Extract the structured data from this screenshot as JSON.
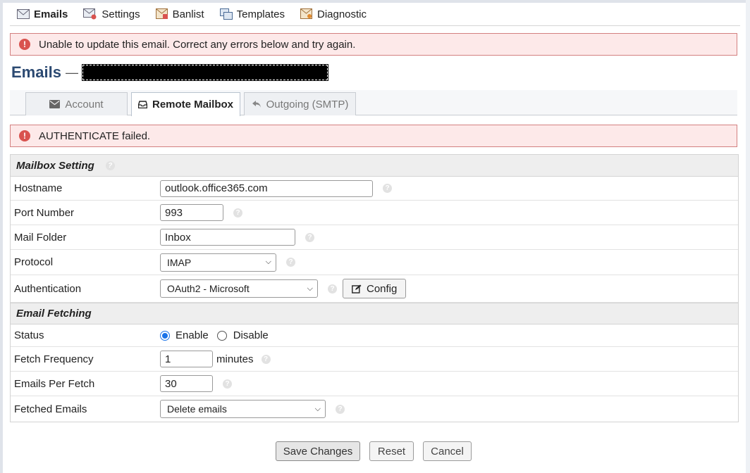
{
  "nav": {
    "items": [
      {
        "label": "Emails",
        "icon": "envelope-icon"
      },
      {
        "label": "Settings",
        "icon": "settings-envelope-icon"
      },
      {
        "label": "Banlist",
        "icon": "banlist-icon"
      },
      {
        "label": "Templates",
        "icon": "templates-icon"
      },
      {
        "label": "Diagnostic",
        "icon": "diagnostic-icon"
      }
    ]
  },
  "alerts": {
    "top": "Unable to update this email. Correct any errors below and try again.",
    "auth": "AUTHENTICATE failed."
  },
  "page": {
    "title": "Emails",
    "separator": "—"
  },
  "tabs": [
    {
      "label": "Account",
      "icon": "envelope-icon"
    },
    {
      "label": "Remote Mailbox",
      "icon": "inbox-icon"
    },
    {
      "label": "Outgoing (SMTP)",
      "icon": "reply-icon"
    }
  ],
  "mailbox": {
    "heading": "Mailbox Setting",
    "hostname": {
      "label": "Hostname",
      "value": "outlook.office365.com"
    },
    "port": {
      "label": "Port Number",
      "value": "993"
    },
    "folder": {
      "label": "Mail Folder",
      "value": "Inbox"
    },
    "protocol": {
      "label": "Protocol",
      "value": "IMAP"
    },
    "auth": {
      "label": "Authentication",
      "value": "OAuth2 - Microsoft",
      "config_label": "Config"
    }
  },
  "fetching": {
    "heading": "Email Fetching",
    "status": {
      "label": "Status",
      "enable": "Enable",
      "disable": "Disable",
      "selected": "Enable"
    },
    "frequency": {
      "label": "Fetch Frequency",
      "value": "1",
      "unit": "minutes"
    },
    "per_fetch": {
      "label": "Emails Per Fetch",
      "value": "30"
    },
    "fetched": {
      "label": "Fetched Emails",
      "value": "Delete emails"
    }
  },
  "actions": {
    "save": "Save Changes",
    "reset": "Reset",
    "cancel": "Cancel"
  },
  "colors": {
    "title": "#2c4a72",
    "error_bg": "#fde9e9",
    "error_border": "#d38080",
    "error_icon": "#d9534f",
    "radio_on": "#1a73e8"
  }
}
